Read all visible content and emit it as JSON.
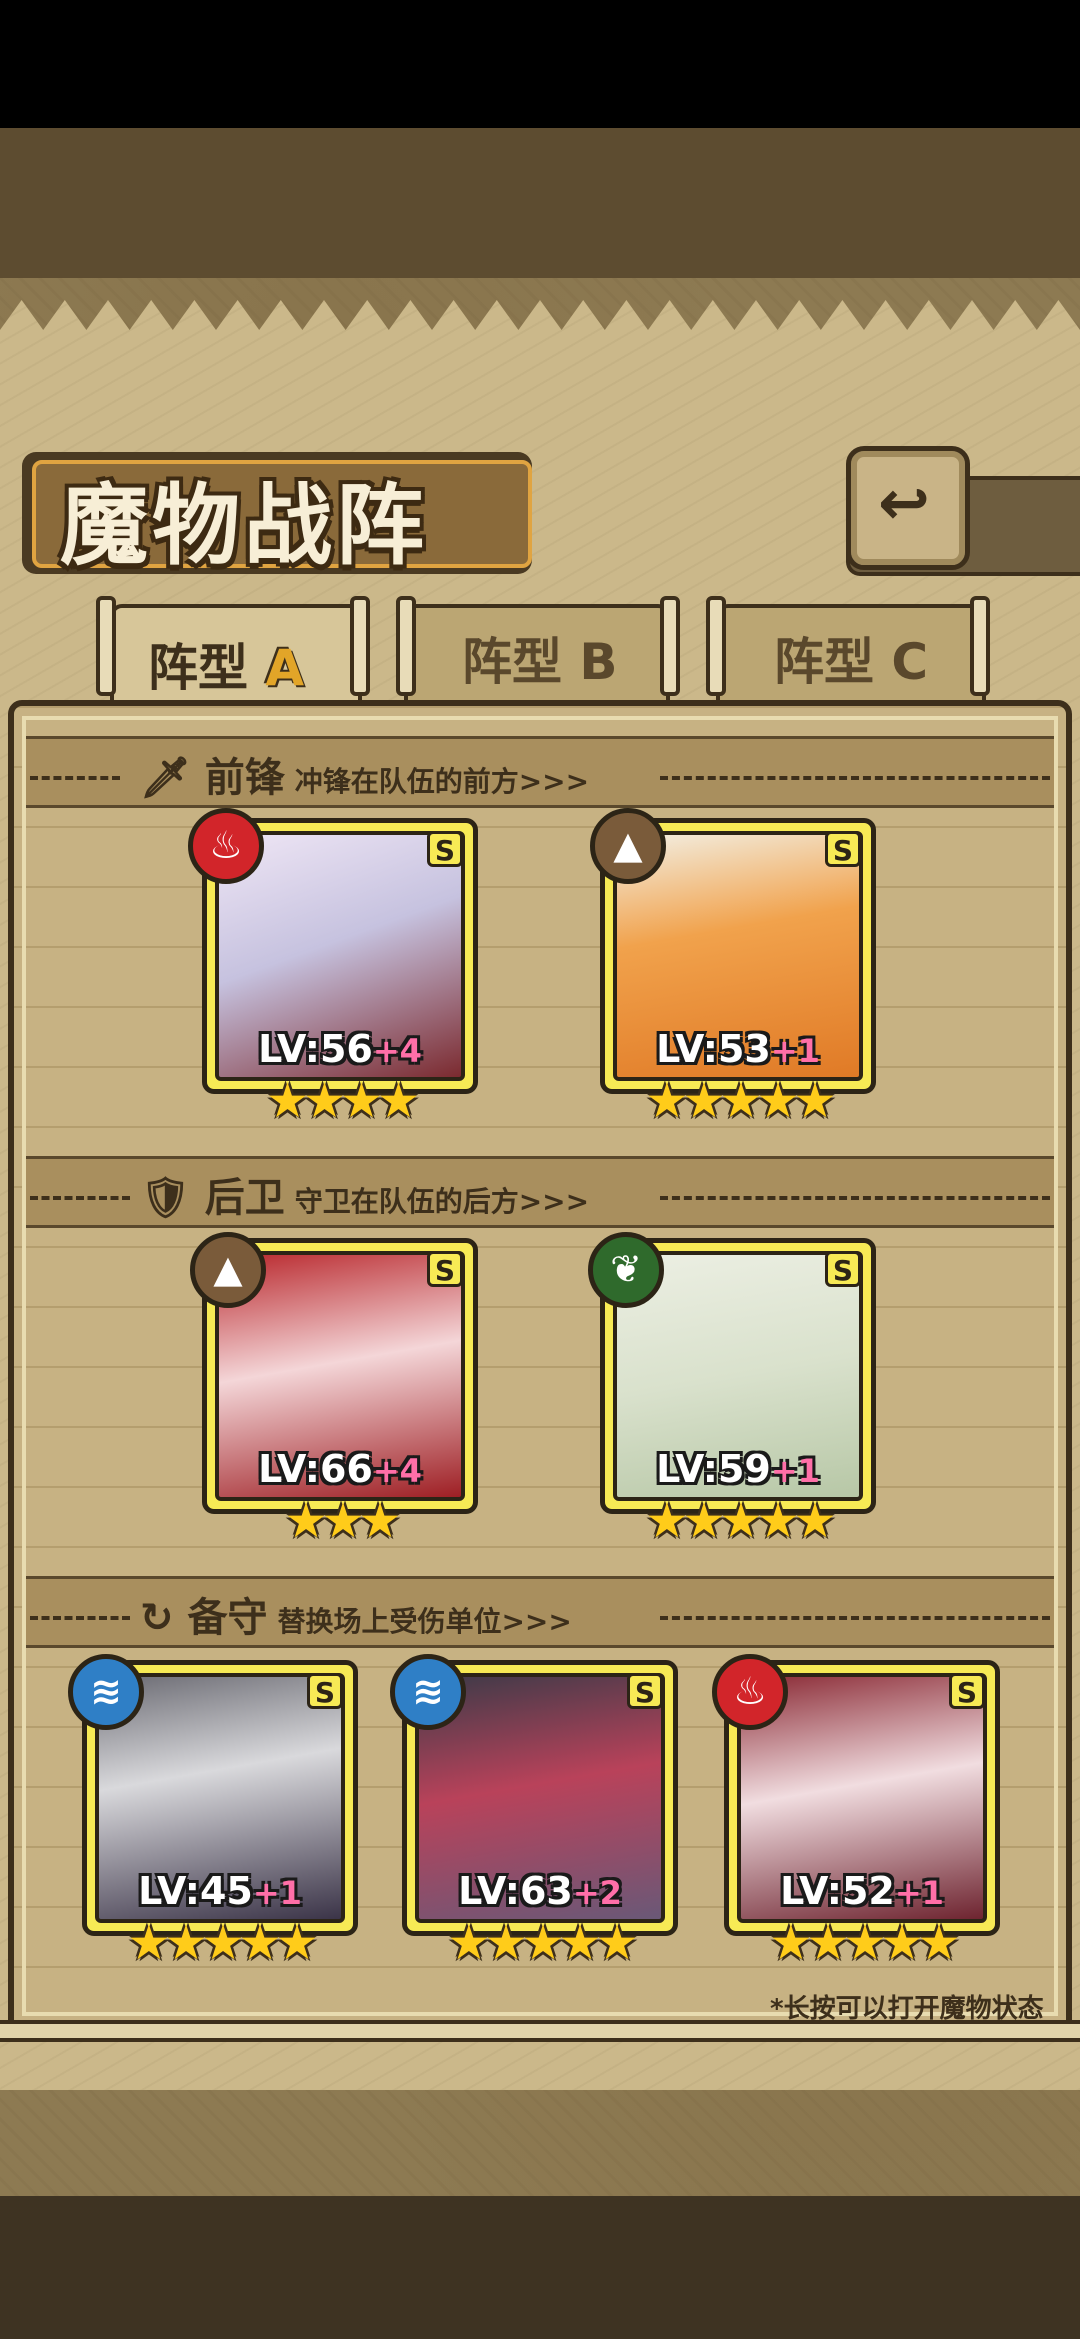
{
  "title": "魔物战阵",
  "tabs": [
    {
      "label": "阵型",
      "letter": "A",
      "active": true
    },
    {
      "label": "阵型",
      "letter": "B",
      "active": false
    },
    {
      "label": "阵型",
      "letter": "C",
      "active": false
    }
  ],
  "sections": {
    "front": {
      "title": "前锋",
      "subtitle": "冲锋在队伍的前方>>>"
    },
    "back": {
      "title": "后卫",
      "subtitle": "守卫在队伍的后方>>>"
    },
    "reserve": {
      "title": "备守",
      "subtitle": "替换场上受伤单位>>>"
    }
  },
  "units": {
    "front": [
      {
        "level": "LV:56",
        "bonus": "+4",
        "rank": "S",
        "element": "fire",
        "stars": "★★★★"
      },
      {
        "level": "LV:53",
        "bonus": "+1",
        "rank": "S",
        "element": "earth",
        "stars": "★★★★★"
      }
    ],
    "back": [
      {
        "level": "LV:66",
        "bonus": "+4",
        "rank": "S",
        "element": "earth",
        "stars": "★★★"
      },
      {
        "level": "LV:59",
        "bonus": "+1",
        "rank": "S",
        "element": "wind",
        "stars": "★★★★★"
      }
    ],
    "reserve": [
      {
        "level": "LV:45",
        "bonus": "+1",
        "rank": "S",
        "element": "water",
        "stars": "★★★★★"
      },
      {
        "level": "LV:63",
        "bonus": "+2",
        "rank": "S",
        "element": "water",
        "stars": "★★★★★"
      },
      {
        "level": "LV:52",
        "bonus": "+1",
        "rank": "S",
        "element": "fire",
        "stars": "★★★★★"
      }
    ]
  },
  "hint": "*长按可以打开魔物状态",
  "colors": {
    "card": "#f7ea55",
    "fire": "#d2252a",
    "earth": "#7a5b3a",
    "wind": "#2f6a2c",
    "water": "#2f7fc6"
  }
}
